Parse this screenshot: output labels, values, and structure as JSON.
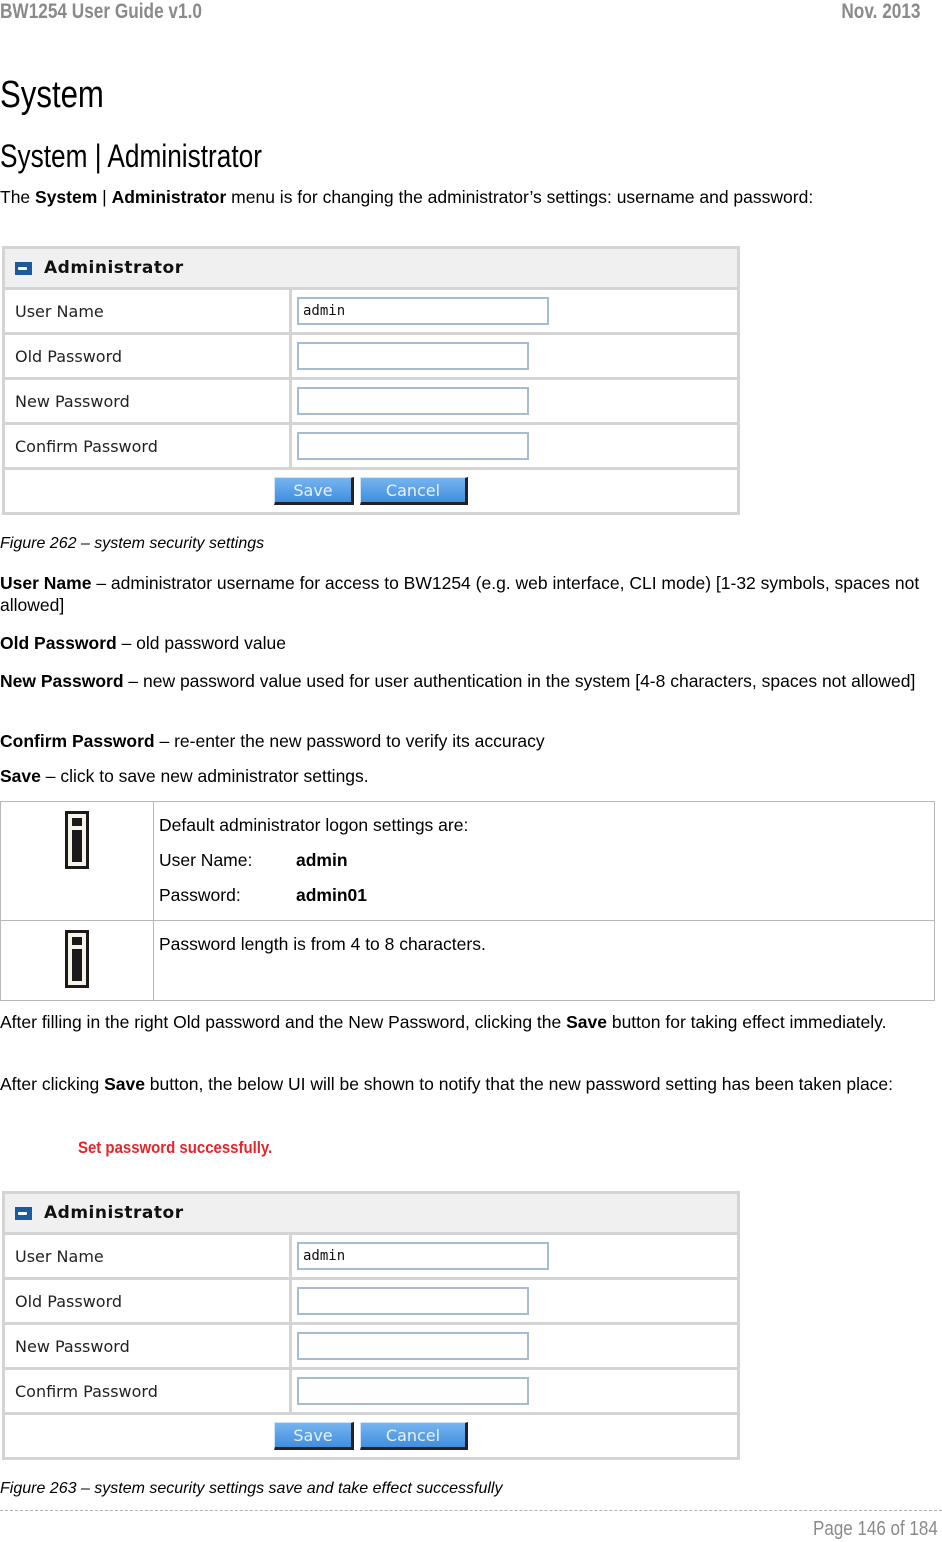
{
  "header": {
    "doc_title": "BW1254 User Guide v1.0",
    "date": "Nov.  2013"
  },
  "section_title": "System",
  "subsection_title": "System | Administrator",
  "intro": {
    "prefix": "The ",
    "bold1": "System",
    "sep": " | ",
    "bold2": "Administrator",
    "suffix": " menu is for changing the administrator’s settings: username and password:"
  },
  "panel1": {
    "title": "Administrator",
    "icon": "key-icon",
    "fields": [
      {
        "label": "User Name",
        "value": ""
      },
      {
        "label": "Old Password",
        "value": ""
      },
      {
        "label": "New Password",
        "value": ""
      },
      {
        "label": "Confirm Password",
        "value": ""
      }
    ],
    "username_value": "admin",
    "save_label": "Save",
    "cancel_label": "Cancel"
  },
  "figure1_caption": "Figure 262 – system security settings",
  "definitions": [
    {
      "term": "User Name",
      "text": " – administrator username for access to BW1254 (e.g. web interface, CLI mode) [1-32 symbols, spaces not allowed]"
    },
    {
      "term": "Old Password",
      "text": " – old password value"
    },
    {
      "term": "New Password",
      "text": " – new password value used for user authentication in the system [4-8 characters, spaces not allowed]"
    },
    {
      "term": "Confirm Password",
      "text": " – re-enter the new password to verify its accuracy"
    },
    {
      "term": "Save",
      "text": " – click to save new administrator settings."
    }
  ],
  "notes": {
    "icon": "info-icon",
    "note1": {
      "intro": "Default administrator logon settings are:",
      "user_label": "User Name:",
      "user_value": "admin",
      "pass_label": "Password:",
      "pass_value": "admin01"
    },
    "note2": "Password length is from 4 to 8 characters."
  },
  "after1": {
    "prefix": "After filling in the right Old password and the New Password, clicking the ",
    "bold": "Save",
    "suffix": " button for taking effect immediately."
  },
  "after2": {
    "prefix": "After clicking ",
    "bold": "Save",
    "suffix": " button, the below UI will be shown to notify that the new password setting has been taken place:"
  },
  "success_message": "Set password successfully.",
  "success_color": "#e8242a",
  "panel2": {
    "title": "Administrator",
    "fields": [
      {
        "label": "User Name"
      },
      {
        "label": "Old Password"
      },
      {
        "label": "New Password"
      },
      {
        "label": "Confirm Password"
      }
    ],
    "username_value": "admin",
    "save_label": "Save",
    "cancel_label": "Cancel"
  },
  "figure2_caption": "Figure 263 – system security settings save and take effect successfully",
  "footer": {
    "page": "Page 146 of 184"
  }
}
